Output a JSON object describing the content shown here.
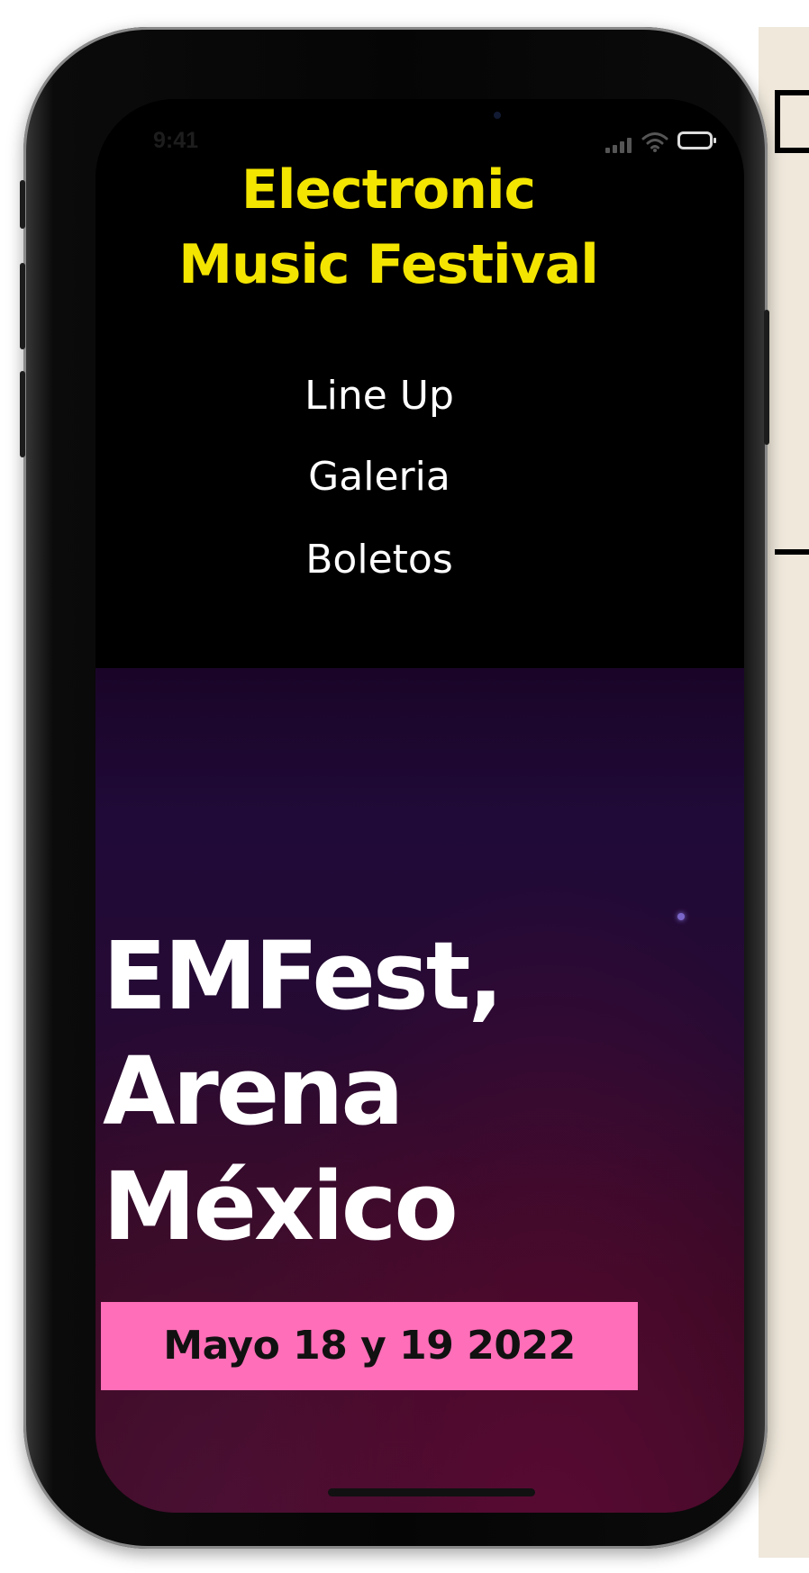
{
  "status_bar": {
    "time": "9:41",
    "icons": [
      "signal-icon",
      "wifi-icon",
      "battery-icon"
    ]
  },
  "header": {
    "title_line_1": "Electronic",
    "title_line_2": "Music Festival",
    "title_color": "#f3e500"
  },
  "nav": {
    "items": [
      {
        "label": "Line Up"
      },
      {
        "label": "Galeria"
      },
      {
        "label": "Boletos"
      }
    ]
  },
  "hero": {
    "title_line_1": "EMFest,",
    "title_line_2": "Arena",
    "title_line_3": "México",
    "date": "Mayo 18 y 19 2022",
    "date_badge_color": "#ff6eb8"
  }
}
